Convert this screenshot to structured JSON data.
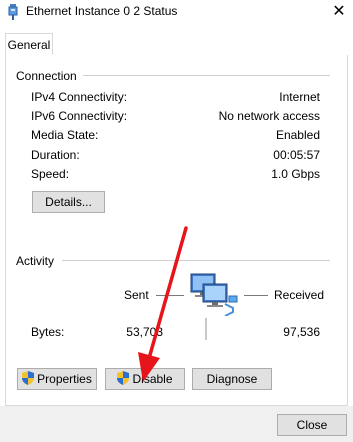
{
  "window": {
    "title": "Ethernet Instance 0 2 Status",
    "close_glyph": "✕"
  },
  "tabs": [
    {
      "label": "General",
      "selected": true
    }
  ],
  "connection": {
    "group_label": "Connection",
    "rows": [
      {
        "label": "IPv4 Connectivity:",
        "value": "Internet"
      },
      {
        "label": "IPv6 Connectivity:",
        "value": "No network access"
      },
      {
        "label": "Media State:",
        "value": "Enabled"
      },
      {
        "label": "Duration:",
        "value": "00:05:57"
      },
      {
        "label": "Speed:",
        "value": "1.0 Gbps"
      }
    ],
    "details_button": "Details..."
  },
  "activity": {
    "group_label": "Activity",
    "sent_label": "Sent",
    "received_label": "Received",
    "bytes_label": "Bytes:",
    "bytes_sent": "53,703",
    "bytes_received": "97,536",
    "network_icon": "network-computers-icon"
  },
  "actions": {
    "properties": "Properties",
    "disable": "Disable",
    "diagnose": "Diagnose",
    "shield_icon": "uac-shield-icon"
  },
  "footer": {
    "close": "Close"
  },
  "annotation": {
    "arrow_color": "#e8141b"
  }
}
